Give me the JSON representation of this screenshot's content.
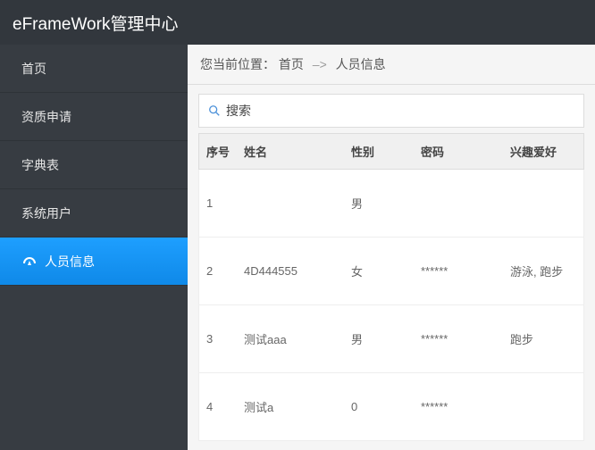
{
  "header": {
    "title": "eFrameWork管理中心"
  },
  "sidebar": {
    "items": [
      {
        "label": "首页"
      },
      {
        "label": "资质申请"
      },
      {
        "label": "字典表"
      },
      {
        "label": "系统用户"
      },
      {
        "label": "人员信息"
      }
    ]
  },
  "breadcrumb": {
    "prefix": "您当前位置：",
    "home": "首页",
    "sep": "–>",
    "current": "人员信息"
  },
  "search": {
    "label": "搜索"
  },
  "table": {
    "headers": {
      "seq": "序号",
      "name": "姓名",
      "gender": "性别",
      "pwd": "密码",
      "hobby": "兴趣爱好"
    },
    "rows": [
      {
        "seq": "1",
        "name": "",
        "gender": "男",
        "pwd": "",
        "hobby": ""
      },
      {
        "seq": "2",
        "name": "4D444555",
        "gender": "女",
        "pwd": "******",
        "hobby": "游泳, 跑步"
      },
      {
        "seq": "3",
        "name": "测试aaa",
        "gender": "男",
        "pwd": "******",
        "hobby": "跑步"
      },
      {
        "seq": "4",
        "name": "测试a",
        "gender": "0",
        "pwd": "******",
        "hobby": ""
      }
    ]
  }
}
